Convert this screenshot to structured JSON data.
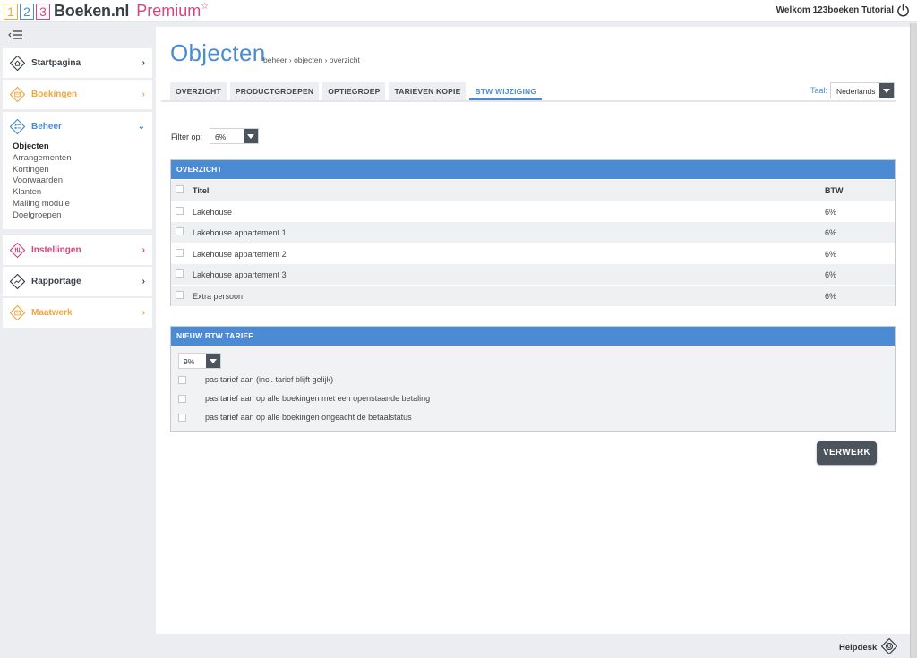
{
  "brand": {
    "digits": [
      "1",
      "2",
      "3"
    ],
    "name": "Boeken.nl",
    "tier": "Premium",
    "star": "☆"
  },
  "header": {
    "welcome": "Welkom 123boeken Tutorial"
  },
  "sidebar": {
    "items": [
      {
        "label": "Startpagina",
        "chevron": "›"
      },
      {
        "label": "Boekingen",
        "chevron": "›"
      },
      {
        "label": "Beheer",
        "chevron": "⌄",
        "sub": [
          "Objecten",
          "Arrangementen",
          "Kortingen",
          "Voorwaarden",
          "Klanten",
          "Mailing module",
          "Doelgroepen"
        ]
      },
      {
        "label": "Instellingen",
        "chevron": "›"
      },
      {
        "label": "Rapportage",
        "chevron": "›"
      },
      {
        "label": "Maatwerk",
        "chevron": "›"
      }
    ]
  },
  "page": {
    "title": "Objecten",
    "breadcrumb": {
      "b1": "beheer",
      "sep": "›",
      "b2": "objecten",
      "b3": "overzicht"
    }
  },
  "tabs": [
    "OVERZICHT",
    "PRODUCTGROEPEN",
    "OPTIEGROEP",
    "TARIEVEN KOPIE",
    "BTW WIJZIGING"
  ],
  "language": {
    "label": "Taal:",
    "value": "Nederlands"
  },
  "filter": {
    "label": "Filter op:",
    "value": "6%"
  },
  "overview": {
    "title": "OVERZICHT",
    "columns": {
      "titel": "Titel",
      "btw": "BTW"
    },
    "rows": [
      {
        "titel": "Lakehouse",
        "btw": "6%"
      },
      {
        "titel": "Lakehouse appartement 1",
        "btw": "6%"
      },
      {
        "titel": "Lakehouse appartement 2",
        "btw": "6%"
      },
      {
        "titel": "Lakehouse appartement 3",
        "btw": "6%"
      },
      {
        "titel": "Extra persoon",
        "btw": "6%"
      }
    ]
  },
  "new_rate": {
    "title": "NIEUW BTW TARIEF",
    "value": "9%",
    "options": [
      "pas tarief aan (incl. tarief blijft gelijk)",
      "pas tarief aan op alle boekingen met een openstaande betaling",
      "pas tarief aan op alle boekingen ongeacht de betaalstatus"
    ]
  },
  "actions": {
    "process": "VERWERK"
  },
  "footer": {
    "helpdesk": "Helpdesk"
  },
  "colors": {
    "accent": "#4a8bd4",
    "orange": "#f0a640",
    "pink": "#d6457c",
    "dark": "#4b535d"
  }
}
